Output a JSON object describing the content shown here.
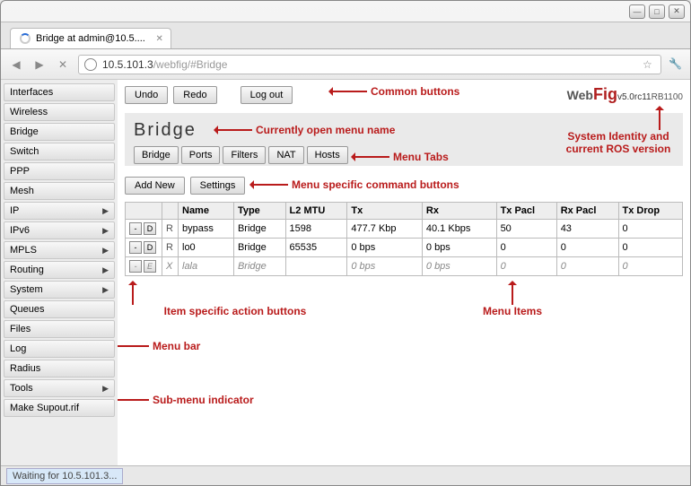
{
  "window": {
    "tab_title": "Bridge at admin@10.5....",
    "url_host": "10.5.101.3",
    "url_path": "/webfig/#Bridge",
    "status": "Waiting for 10.5.101.3..."
  },
  "sidebar": {
    "items": [
      {
        "label": "Interfaces",
        "sub": false
      },
      {
        "label": "Wireless",
        "sub": false
      },
      {
        "label": "Bridge",
        "sub": false
      },
      {
        "label": "Switch",
        "sub": false
      },
      {
        "label": "PPP",
        "sub": false
      },
      {
        "label": "Mesh",
        "sub": false
      },
      {
        "label": "IP",
        "sub": true
      },
      {
        "label": "IPv6",
        "sub": true
      },
      {
        "label": "MPLS",
        "sub": true
      },
      {
        "label": "Routing",
        "sub": true
      },
      {
        "label": "System",
        "sub": true
      },
      {
        "label": "Queues",
        "sub": false
      },
      {
        "label": "Files",
        "sub": false
      },
      {
        "label": "Log",
        "sub": false
      },
      {
        "label": "Radius",
        "sub": false
      },
      {
        "label": "Tools",
        "sub": true
      },
      {
        "label": "Make Supout.rif",
        "sub": false
      }
    ]
  },
  "toolbar": {
    "undo": "Undo",
    "redo": "Redo",
    "logout": "Log out"
  },
  "logo": {
    "web": "Web",
    "fig": "Fig",
    "version": "v5.0rc11",
    "board": "RB1100"
  },
  "page": {
    "title": "Bridge",
    "tabs": [
      "Bridge",
      "Ports",
      "Filters",
      "NAT",
      "Hosts"
    ],
    "commands": {
      "addnew": "Add New",
      "settings": "Settings"
    }
  },
  "table": {
    "headers": [
      "",
      "",
      "Name",
      "Type",
      "L2 MTU",
      "Tx",
      "Rx",
      "Tx Pacl",
      "Rx Pacl",
      "Tx Drop"
    ],
    "rows": [
      {
        "btns": [
          "-",
          "D"
        ],
        "flag": "R",
        "name": "bypass",
        "type": "Bridge",
        "l2mtu": "1598",
        "tx": "477.7 Kbp",
        "rx": "40.1 Kbps",
        "txp": "50",
        "rxp": "43",
        "txd": "0",
        "disabled": false
      },
      {
        "btns": [
          "-",
          "D"
        ],
        "flag": "R",
        "name": "lo0",
        "type": "Bridge",
        "l2mtu": "65535",
        "tx": "0 bps",
        "rx": "0 bps",
        "txp": "0",
        "rxp": "0",
        "txd": "0",
        "disabled": false
      },
      {
        "btns": [
          "-",
          "E"
        ],
        "flag": "X",
        "name": "lala",
        "type": "Bridge",
        "l2mtu": "",
        "tx": "0 bps",
        "rx": "0 bps",
        "txp": "0",
        "rxp": "0",
        "txd": "0",
        "disabled": true
      }
    ]
  },
  "annotations": {
    "common_buttons": "Common buttons",
    "menu_name": "Currently open menu name",
    "identity": "System Identity and current ROS version",
    "menu_tabs": "Menu Tabs",
    "cmd_buttons": "Menu specific command buttons",
    "item_buttons": "Item specific action buttons",
    "menu_items": "Menu Items",
    "menu_bar": "Menu bar",
    "submenu": "Sub-menu indicator"
  }
}
